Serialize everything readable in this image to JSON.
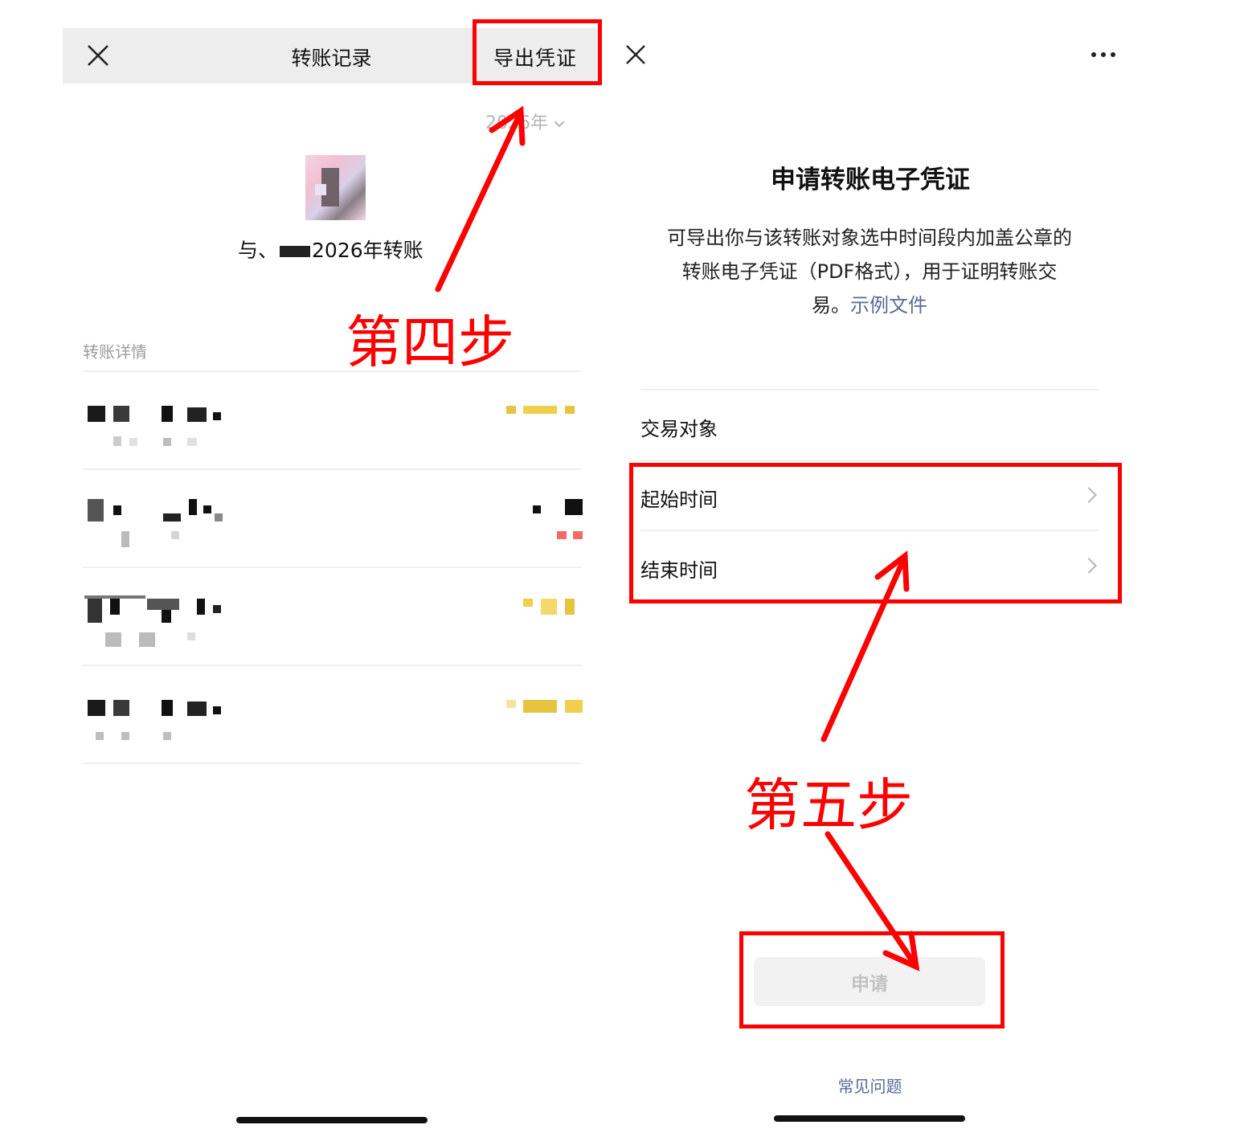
{
  "left": {
    "nav": {
      "title": "转账记录",
      "export_label": "导出凭证"
    },
    "year_label": "2026年",
    "with_prefix": "与、",
    "with_suffix": "2026年转账",
    "section_label": "转账详情"
  },
  "right": {
    "title": "申请转账电子凭证",
    "desc_line1": "可导出你与该转账对象选中时间段内加盖公章的",
    "desc_line2": "转账电子凭证（PDF格式），用于证明转账交",
    "desc_line3": "易。",
    "sample_link": "示例文件",
    "items": [
      {
        "label": "交易对象"
      },
      {
        "label": "起始时间"
      },
      {
        "label": "结束时间"
      }
    ],
    "apply_label": "申请",
    "faq_label": "常见问题"
  },
  "annotations": {
    "step4": "第四步",
    "step5": "第五步",
    "color": "#ff0000"
  },
  "icons": [
    "close-icon",
    "chevron-down-icon",
    "more-icon",
    "chevron-right-icon"
  ],
  "colors": {
    "link": "#576b95",
    "nav_bg": "#ededed",
    "annotation": "#ff0000"
  }
}
